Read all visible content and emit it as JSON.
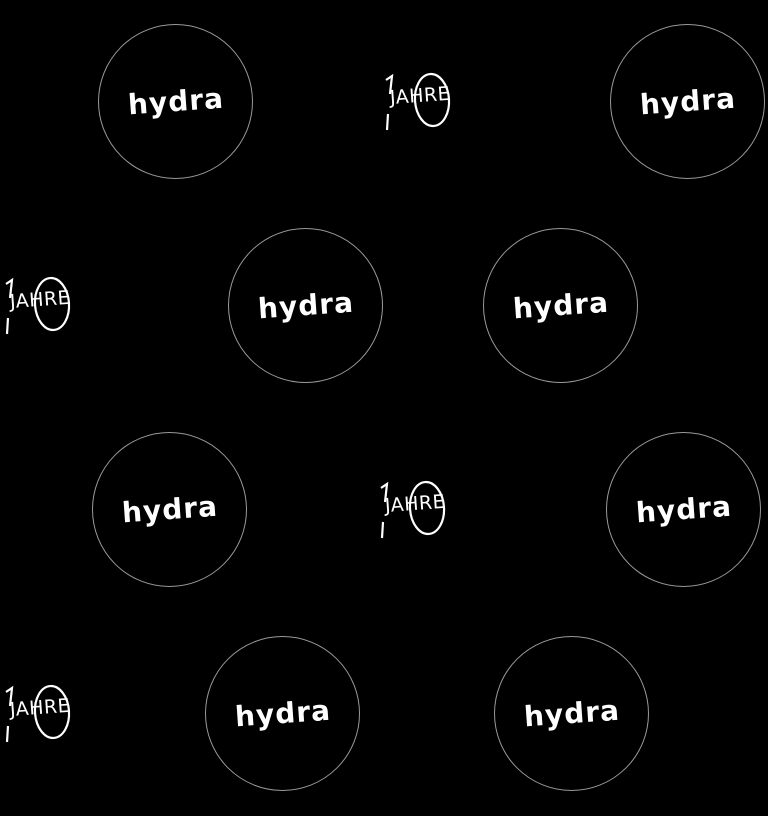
{
  "pattern": {
    "brand_text": "hydra",
    "anniversary_number": "10",
    "anniversary_word": "JAHRE",
    "background_color": "#000000",
    "foreground_color": "#ffffff",
    "circle_outline_color": "#9a9a9a"
  }
}
